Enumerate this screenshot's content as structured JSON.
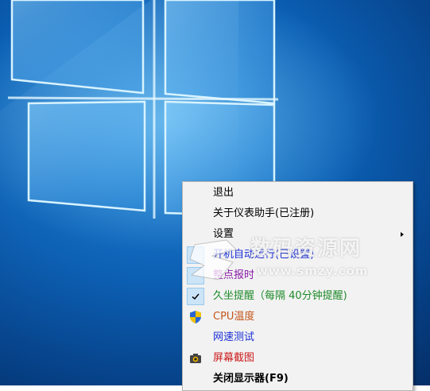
{
  "colors": {
    "desktop_dark": "#063f84",
    "desktop_light": "#1a82d6",
    "menu_bg": "#f2f2f2",
    "item_blue": "#1a2fd6",
    "item_purple": "#8a1aa8",
    "item_green": "#1e8a2a",
    "item_orange": "#c4571b",
    "item_red": "#cc1a1a",
    "check_bg": "#cce4f7"
  },
  "menu": {
    "items": [
      {
        "label": "退出",
        "icon": "",
        "color": "#000000",
        "bold": false
      },
      {
        "label": "关于仪表助手(已注册)",
        "icon": "",
        "color": "#000000",
        "bold": false
      },
      {
        "label": "设置",
        "icon": "",
        "color": "#000000",
        "bold": false,
        "has_submenu": true
      },
      {
        "label": "开机自动运行(已设置)",
        "icon": "",
        "color": "#1a2fd6",
        "bold": false,
        "checked_bg": true
      },
      {
        "label": "整点报时",
        "icon": "",
        "color": "#8a1aa8",
        "bold": false,
        "checked_bg": true
      },
      {
        "label": "久坐提醒（每隔 40分钟提醒)",
        "icon": "check-icon",
        "color": "#1e8a2a",
        "bold": false,
        "checked_bg": true
      },
      {
        "label": "CPU温度",
        "icon": "uac-shield-icon",
        "color": "#c4571b",
        "bold": false
      },
      {
        "label": "网速测试",
        "icon": "",
        "color": "#1a2fd6",
        "bold": false
      },
      {
        "label": "屏幕截图",
        "icon": "camera-icon",
        "color": "#cc1a1a",
        "bold": false
      },
      {
        "label": "关闭显示器(F9)",
        "icon": "",
        "color": "#000000",
        "bold": true
      }
    ]
  },
  "watermark": {
    "text": "数码资源网",
    "url": "www.smzy.com"
  }
}
